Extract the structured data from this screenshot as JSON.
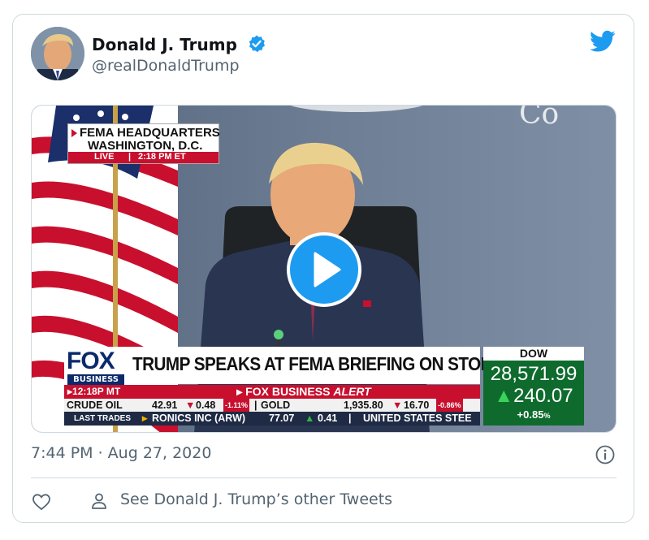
{
  "tweet": {
    "display_name": "Donald J. Trump",
    "handle": "@realDonaldTrump",
    "verified": true,
    "timestamp": "7:44 PM · Aug 27, 2020",
    "see_others": "See Donald J. Trump’s other Tweets"
  },
  "icons": {
    "verified": "verified-badge-icon",
    "brand": "twitter-bird-icon",
    "play": "play-icon",
    "info": "info-icon",
    "like": "heart-icon",
    "profile": "person-icon"
  },
  "video": {
    "location_line1": "FEMA HEADQUARTERS",
    "location_line2": "WASHINGTON, D.C.",
    "live_label": "LIVE",
    "live_time": "2:18 PM ET",
    "network_logo": "FOX",
    "network_sub": "BUSINESS",
    "clock": "12:18P MT",
    "headline": "TRUMP SPEAKS AT FEMA BRIEFING ON STORM LAURA",
    "alert_brand": "FOX BUSINESS",
    "alert_word": "ALERT",
    "ticker_row1": {
      "item1_name": "CRUDE OIL",
      "item1_price": "42.91",
      "item1_change": "0.48",
      "item1_pct": "-1.11%",
      "item2_name": "GOLD",
      "item2_price": "1,935.80",
      "item2_change": "16.70",
      "item2_pct": "-0.86%"
    },
    "ticker_row2": {
      "label": "LAST TRADES",
      "item1_name": "RONICS INC (ARW)",
      "item1_price": "77.07",
      "item1_change": "0.41",
      "item2_name": "UNITED STATES STEE"
    },
    "dow": {
      "label": "DOW",
      "value": "28,571.99",
      "change": "240.07",
      "pct": "+0.85",
      "pct_sign": "%"
    },
    "colors": {
      "fox_red": "#c8102e",
      "fox_navy": "#0b2a6b",
      "dow_green": "#0e6b2d",
      "play_blue": "#1d9bf0"
    }
  }
}
